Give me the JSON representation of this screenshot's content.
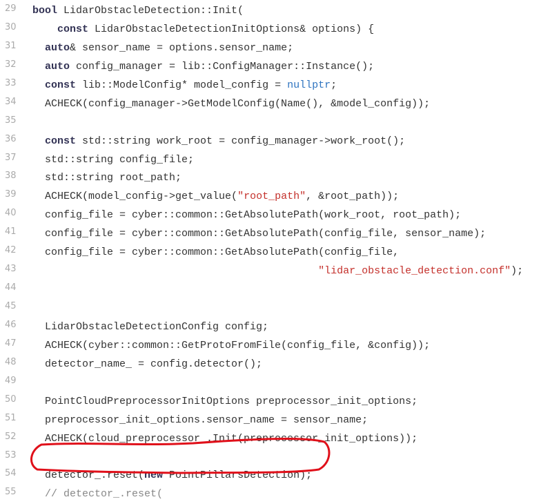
{
  "highlight_color": "#e0101a",
  "colors": {
    "keyword": "#333355",
    "string": "#c4302b",
    "literal": "#2f74c0",
    "comment": "#888888",
    "line_number": "#aaaaaa"
  },
  "lines": [
    {
      "n": "29",
      "t": [
        [
          "kw",
          "bool"
        ],
        [
          "p",
          " LidarObstacleDetection::Init("
        ]
      ]
    },
    {
      "n": "30",
      "t": [
        [
          "p",
          "    "
        ],
        [
          "kw",
          "const"
        ],
        [
          "p",
          " LidarObstacleDetectionInitOptions& options) {"
        ]
      ]
    },
    {
      "n": "31",
      "t": [
        [
          "p",
          "  "
        ],
        [
          "kw",
          "auto"
        ],
        [
          "p",
          "& sensor_name = options.sensor_name;"
        ]
      ]
    },
    {
      "n": "32",
      "t": [
        [
          "p",
          "  "
        ],
        [
          "kw",
          "auto"
        ],
        [
          "p",
          " config_manager = lib::ConfigManager::Instance();"
        ]
      ]
    },
    {
      "n": "33",
      "t": [
        [
          "p",
          "  "
        ],
        [
          "kw",
          "const"
        ],
        [
          "p",
          " lib::ModelConfig* model_config = "
        ],
        [
          "lit",
          "nullptr"
        ],
        [
          "p",
          ";"
        ]
      ]
    },
    {
      "n": "34",
      "t": [
        [
          "p",
          "  ACHECK(config_manager->GetModelConfig(Name(), &model_config));"
        ]
      ]
    },
    {
      "n": "35",
      "t": []
    },
    {
      "n": "36",
      "t": [
        [
          "p",
          "  "
        ],
        [
          "kw",
          "const"
        ],
        [
          "p",
          " std::string work_root = config_manager->work_root();"
        ]
      ]
    },
    {
      "n": "37",
      "t": [
        [
          "p",
          "  std::string config_file;"
        ]
      ]
    },
    {
      "n": "38",
      "t": [
        [
          "p",
          "  std::string root_path;"
        ]
      ]
    },
    {
      "n": "39",
      "t": [
        [
          "p",
          "  ACHECK(model_config->get_value("
        ],
        [
          "str",
          "\"root_path\""
        ],
        [
          "p",
          ", &root_path));"
        ]
      ]
    },
    {
      "n": "40",
      "t": [
        [
          "p",
          "  config_file = cyber::common::GetAbsolutePath(work_root, root_path);"
        ]
      ]
    },
    {
      "n": "41",
      "t": [
        [
          "p",
          "  config_file = cyber::common::GetAbsolutePath(config_file, sensor_name);"
        ]
      ]
    },
    {
      "n": "42",
      "t": [
        [
          "p",
          "  config_file = cyber::common::GetAbsolutePath(config_file,"
        ]
      ]
    },
    {
      "n": "43",
      "t": [
        [
          "p",
          "                                              "
        ],
        [
          "str",
          "\"lidar_obstacle_detection.conf\""
        ],
        [
          "p",
          ");"
        ]
      ]
    },
    {
      "n": "44",
      "t": []
    },
    {
      "n": "45",
      "t": []
    },
    {
      "n": "46",
      "t": [
        [
          "p",
          "  LidarObstacleDetectionConfig config;"
        ]
      ]
    },
    {
      "n": "47",
      "t": [
        [
          "p",
          "  ACHECK(cyber::common::GetProtoFromFile(config_file, &config));"
        ]
      ]
    },
    {
      "n": "48",
      "t": [
        [
          "p",
          "  detector_name_ = config.detector();"
        ]
      ]
    },
    {
      "n": "49",
      "t": []
    },
    {
      "n": "50",
      "t": [
        [
          "p",
          "  PointCloudPreprocessorInitOptions preprocessor_init_options;"
        ]
      ]
    },
    {
      "n": "51",
      "t": [
        [
          "p",
          "  preprocessor_init_options.sensor_name = sensor_name;"
        ]
      ]
    },
    {
      "n": "52",
      "t": [
        [
          "p",
          "  ACHECK(cloud_preprocessor_.Init(preprocessor_init_options));"
        ]
      ]
    },
    {
      "n": "53",
      "t": []
    },
    {
      "n": "54",
      "t": [
        [
          "p",
          "  detector_.reset("
        ],
        [
          "kw",
          "new"
        ],
        [
          "p",
          " PointPillarsDetection);"
        ]
      ]
    },
    {
      "n": "55",
      "t": [
        [
          "p",
          "  "
        ],
        [
          "cm",
          "// detector_.reset("
        ]
      ]
    }
  ]
}
